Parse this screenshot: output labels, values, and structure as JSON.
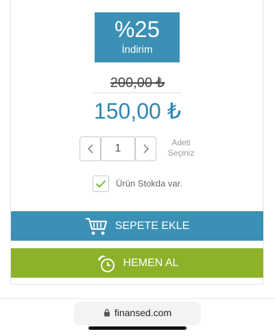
{
  "discount": {
    "percent": "%25",
    "label": "İndirim"
  },
  "price": {
    "old": "200,00 ₺",
    "new": "150,00 ₺"
  },
  "quantity": {
    "value": "1",
    "label_line1": "Adeti",
    "label_line2": "Seçiniz"
  },
  "stock": {
    "checked": true,
    "label": "Ürün Stokda var."
  },
  "actions": {
    "add_to_cart": "SEPETE EKLE",
    "buy_now": "HEMEN AL"
  },
  "browser": {
    "url": "finansed.com"
  },
  "colors": {
    "accent_blue": "#3c90b5",
    "accent_green": "#8cb22a",
    "check_green": "#6ebe2f"
  },
  "icons": {
    "cart": "cart-icon",
    "buy": "clock-icon",
    "lock": "lock-icon",
    "minus": "chevron-left-icon",
    "plus": "chevron-right-icon",
    "check": "check-icon"
  }
}
